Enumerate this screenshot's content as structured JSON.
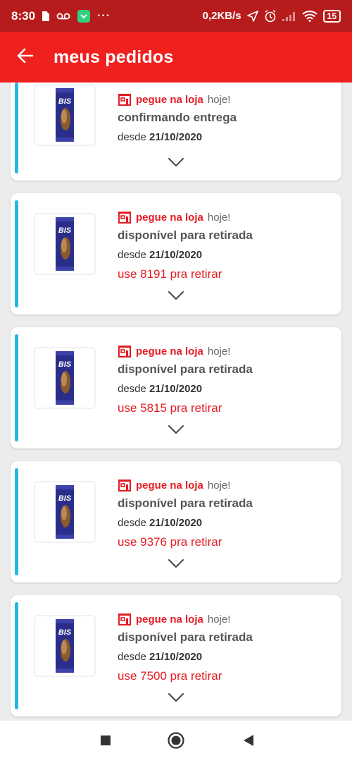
{
  "status_bar": {
    "time": "8:30",
    "network_speed": "0,2KB/s",
    "battery": "15",
    "overflow": "···"
  },
  "app_bar": {
    "title": "meus pedidos"
  },
  "orders": [
    {
      "pickup_label": "pegue na loja",
      "pickup_when": "hoje!",
      "status": "confirmando entrega",
      "since_prefix": "desde",
      "since_date": "21/10/2020",
      "code_text": ""
    },
    {
      "pickup_label": "pegue na loja",
      "pickup_when": "hoje!",
      "status": "disponível para retirada",
      "since_prefix": "desde",
      "since_date": "21/10/2020",
      "code_text": "use 8191 pra retirar"
    },
    {
      "pickup_label": "pegue na loja",
      "pickup_when": "hoje!",
      "status": "disponível para retirada",
      "since_prefix": "desde",
      "since_date": "21/10/2020",
      "code_text": "use 5815 pra retirar"
    },
    {
      "pickup_label": "pegue na loja",
      "pickup_when": "hoje!",
      "status": "disponível para retirada",
      "since_prefix": "desde",
      "since_date": "21/10/2020",
      "code_text": "use 9376 pra retirar"
    },
    {
      "pickup_label": "pegue na loja",
      "pickup_when": "hoje!",
      "status": "disponível para retirada",
      "since_prefix": "desde",
      "since_date": "21/10/2020",
      "code_text": "use 7500 pra retirar"
    }
  ],
  "product_logo_text": "BIS",
  "colors": {
    "status_bar": "#b71c1c",
    "app_bar": "#f0201f",
    "accent_red": "#e41c23",
    "card_accent": "#25b7e4",
    "background": "#ececec"
  },
  "icons": {
    "back": "arrow-left-icon",
    "store": "store-icon",
    "expand": "chevron-down-icon",
    "nav_recents": "square-icon",
    "nav_home": "circle-icon",
    "nav_back": "triangle-back-icon"
  }
}
